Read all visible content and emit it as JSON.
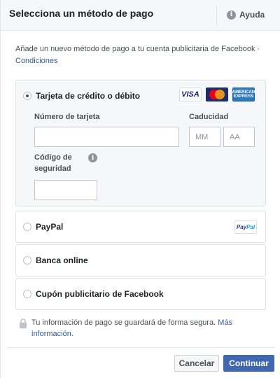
{
  "header": {
    "title": "Selecciona un método de pago",
    "help_label": "Ayuda",
    "help_icon": "i"
  },
  "intro": {
    "text": "Añade un nuevo método de pago a tu cuenta publicitaria de Facebook ·",
    "link": "Condiciones"
  },
  "payment_options": {
    "card": {
      "label": "Tarjeta de crédito o débito",
      "selected": true,
      "logos": [
        "VISA",
        "MasterCard",
        "AMERICAN EXPRESS"
      ],
      "card_number_label": "Número de tarjeta",
      "card_number_value": "",
      "expiry_label": "Caducidad",
      "month_placeholder": "MM",
      "year_placeholder": "AA",
      "security_code_label": "Código de seguridad",
      "security_info_icon": "i",
      "security_code_value": ""
    },
    "paypal": {
      "label": "PayPal",
      "logo_a": "Pay",
      "logo_b": "Pal",
      "selected": false
    },
    "online_banking": {
      "label": "Banca online",
      "selected": false
    },
    "coupon": {
      "label": "Cupón publicitario de Facebook",
      "selected": false
    }
  },
  "secure_note": {
    "text": "Tu información de pago se guardará de forma segura.",
    "link": "Más información."
  },
  "footer": {
    "cancel_label": "Cancelar",
    "continue_label": "Continuar"
  },
  "colors": {
    "primary": "#4267b2",
    "link": "#365899",
    "panel_bg": "#f6f7f9",
    "border": "#dddfe2"
  }
}
